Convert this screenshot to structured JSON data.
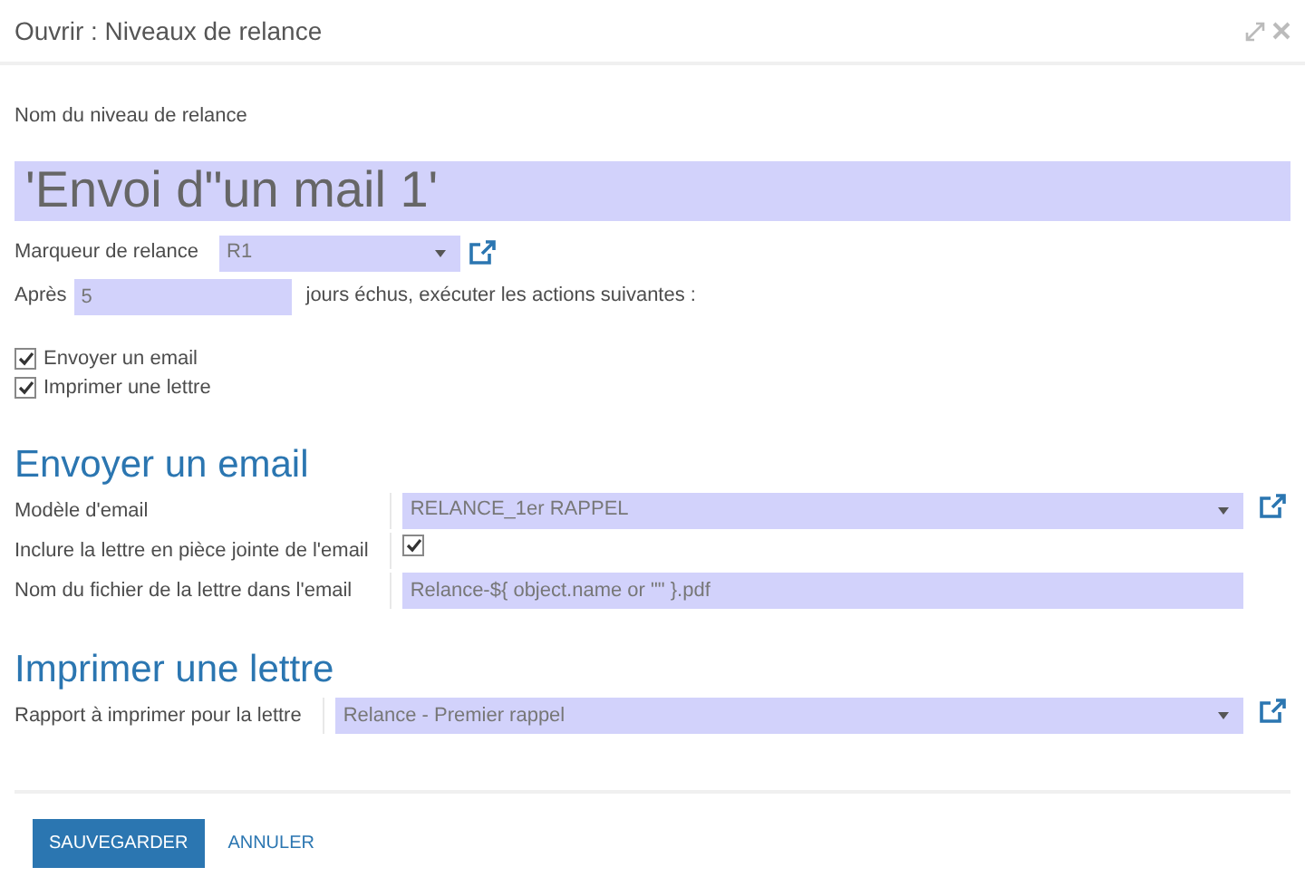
{
  "window": {
    "title": "Ouvrir : Niveaux de relance"
  },
  "name_field": {
    "label": "Nom du niveau de relance",
    "value": "'Envoi d\"un mail 1'"
  },
  "marker": {
    "label": "Marqueur de relance",
    "value": "R1"
  },
  "delay": {
    "prefix": "Après",
    "value": "5",
    "suffix": "jours échus, exécuter les actions suivantes :"
  },
  "actions": [
    {
      "label": "Envoyer un email",
      "checked": true
    },
    {
      "label": "Imprimer une lettre",
      "checked": true
    }
  ],
  "sections": [
    {
      "title": "Envoyer un email",
      "fields": [
        {
          "kind": "select",
          "label": "Modèle d'email",
          "value": "RELANCE_1er RAPPEL"
        },
        {
          "kind": "checkbox",
          "label": "Inclure la lettre en pièce jointe de l'email",
          "checked": true
        },
        {
          "kind": "text",
          "label": "Nom du fichier de la lettre dans l'email",
          "value": "Relance-${ object.name or \"\" }.pdf"
        }
      ]
    },
    {
      "title": "Imprimer une lettre",
      "fields": [
        {
          "kind": "select",
          "label": "Rapport à imprimer pour la lettre",
          "value": "Relance - Premier rappel"
        }
      ]
    }
  ],
  "buttons": [
    {
      "kind": "primary",
      "label": "SAUVEGARDER"
    },
    {
      "kind": "link",
      "label": "ANNULER"
    }
  ]
}
